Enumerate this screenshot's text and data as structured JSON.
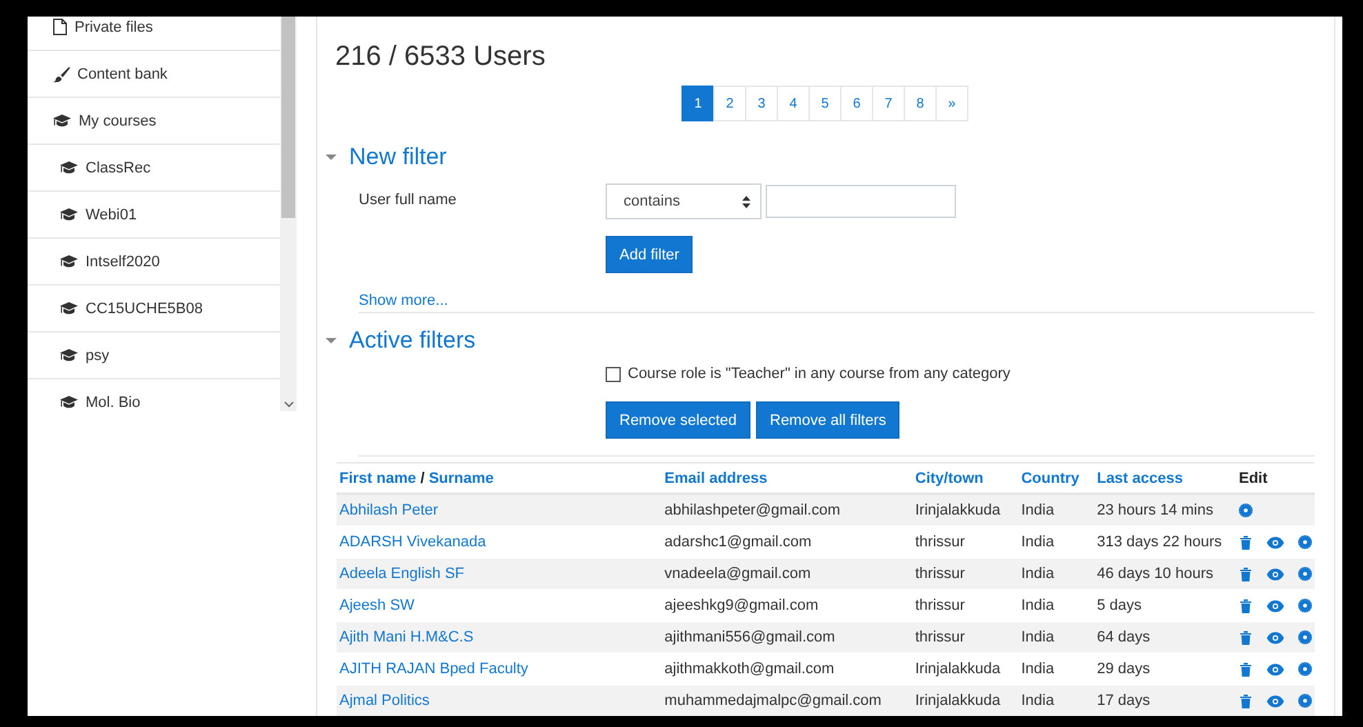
{
  "sidebar": {
    "items": [
      {
        "label": "Private files",
        "kind": "file"
      },
      {
        "label": "Content bank",
        "kind": "content"
      },
      {
        "label": "My courses",
        "kind": "course",
        "children": [
          {
            "label": "ClassRec",
            "kind": "course"
          },
          {
            "label": "Webi01",
            "kind": "course"
          },
          {
            "label": "Intself2020",
            "kind": "course"
          },
          {
            "label": "CC15UCHE5B08",
            "kind": "course"
          },
          {
            "label": "psy",
            "kind": "course"
          },
          {
            "label": "Mol. Bio",
            "kind": "course"
          }
        ]
      }
    ]
  },
  "main": {
    "title": "216 / 6533 Users",
    "pagination": [
      {
        "label": "1",
        "selected": true
      },
      {
        "label": "2",
        "selected": false
      },
      {
        "label": "3",
        "selected": false
      },
      {
        "label": "4",
        "selected": false
      },
      {
        "label": "5",
        "selected": false
      },
      {
        "label": "6",
        "selected": false
      },
      {
        "label": "7",
        "selected": false
      },
      {
        "label": "8",
        "selected": false
      },
      {
        "label": "»",
        "selected": false
      }
    ],
    "new_filter": {
      "heading": "New filter",
      "expanded": true,
      "field_label": "User full name",
      "operator": "contains",
      "add_button": "Add filter",
      "show_more": "Show more..."
    },
    "active_filters": {
      "heading": "Active filters",
      "expanded": true,
      "filters": [
        {
          "label": "Course role is \"Teacher\" in any course from any category",
          "checked": false
        }
      ],
      "buttons": [
        "Remove selected",
        "Remove all filters"
      ]
    },
    "table": {
      "columns": [
        {
          "kind": "sort",
          "links": [
            "First name",
            "Surname"
          ],
          "separator": "/"
        },
        {
          "kind": "sort",
          "links": [
            "Email address"
          ]
        },
        {
          "kind": "sort",
          "links": [
            "City/town"
          ]
        },
        {
          "kind": "sort",
          "links": [
            "Country"
          ]
        },
        {
          "kind": "sort",
          "links": [
            "Last access"
          ]
        },
        {
          "kind": "plain",
          "links": [
            "Edit"
          ]
        }
      ],
      "rows": [
        {
          "name": "Abhilash Peter",
          "email": "abhilashpeter@gmail.com",
          "city": "Irinjalakkuda",
          "country": "India",
          "last_access": "23 hours 14 mins",
          "actions": [
            {
              "kind": "edit"
            }
          ]
        },
        {
          "name": "ADARSH Vivekanada",
          "email": "adarshc1@gmail.com",
          "city": "thrissur",
          "country": "India",
          "last_access": "313 days 22 hours",
          "actions": [
            {
              "kind": "delete"
            },
            {
              "kind": "view"
            },
            {
              "kind": "edit"
            }
          ]
        },
        {
          "name": "Adeela English SF",
          "email": "vnadeela@gmail.com",
          "city": "thrissur",
          "country": "India",
          "last_access": "46 days 10 hours",
          "actions": [
            {
              "kind": "delete"
            },
            {
              "kind": "view"
            },
            {
              "kind": "edit"
            }
          ]
        },
        {
          "name": "Ajeesh SW",
          "email": "ajeeshkg9@gmail.com",
          "city": "thrissur",
          "country": "India",
          "last_access": "5 days",
          "actions": [
            {
              "kind": "delete"
            },
            {
              "kind": "view"
            },
            {
              "kind": "edit"
            }
          ]
        },
        {
          "name": "Ajith Mani H.M&C.S",
          "email": "ajithmani556@gmail.com",
          "city": "thrissur",
          "country": "India",
          "last_access": "64 days",
          "actions": [
            {
              "kind": "delete"
            },
            {
              "kind": "view"
            },
            {
              "kind": "edit"
            }
          ]
        },
        {
          "name": "AJITH RAJAN Bped Faculty",
          "email": "ajithmakkoth@gmail.com",
          "city": "Irinjalakkuda",
          "country": "India",
          "last_access": "29 days",
          "actions": [
            {
              "kind": "delete"
            },
            {
              "kind": "view"
            },
            {
              "kind": "edit"
            }
          ]
        },
        {
          "name": "Ajmal Politics",
          "email": "muhammedajmalpc@gmail.com",
          "city": "Irinjalakkuda",
          "country": "India",
          "last_access": "17 days",
          "actions": [
            {
              "kind": "delete"
            },
            {
              "kind": "view"
            },
            {
              "kind": "edit"
            }
          ]
        }
      ]
    }
  }
}
